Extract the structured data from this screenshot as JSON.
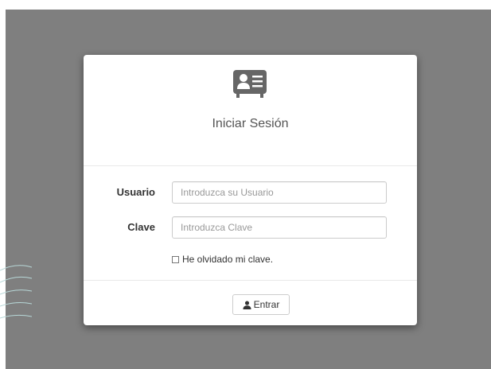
{
  "login": {
    "title": "Iniciar Sesión",
    "header_icon": "id-card-icon",
    "username": {
      "label": "Usuario",
      "placeholder": "Introduzca su Usuario",
      "value": ""
    },
    "password": {
      "label": "Clave",
      "placeholder": "Introduzca Clave",
      "value": ""
    },
    "forgot": {
      "label": "He olvidado mi clave.",
      "checked": false
    },
    "submit": {
      "label": "Entrar",
      "icon": "user-icon"
    }
  },
  "colors": {
    "overlay": "#7f7f7f",
    "card": "#ffffff",
    "icon": "#666666",
    "border": "#cccccc"
  }
}
